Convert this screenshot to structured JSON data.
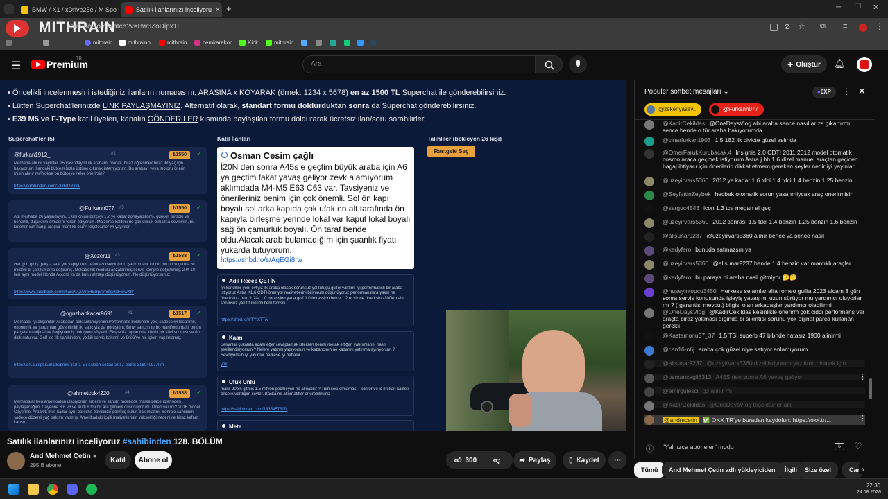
{
  "browser": {
    "tabs": [
      {
        "label": "BMW / X1 / xDrive25e / M Spo"
      },
      {
        "label": "Satılık ilanlarınızı inceliyoru"
      }
    ],
    "url": "youtube.com/watch?v=Bw6ZoDipx1I"
  },
  "bookmarks": [
    "mithrain",
    "mithrainn",
    "mithrain",
    "cemkarakoc",
    "Kick",
    "mithrain"
  ],
  "overlay": {
    "brand": "MITHRAIN"
  },
  "header": {
    "logo": "Premium",
    "logo_sup": "TR",
    "search_placeholder": "Ara",
    "create_label": "Oluştur"
  },
  "video": {
    "lines": [
      {
        "parts": [
          "• Öncelikli incelenmesini istediğiniz ilanların numarasını, ",
          "ARASINA x KOYARAK",
          " (örnek: 1234 x 5678) ",
          "en az 1500 TL",
          " Superchat ile gönderebilirsiniz."
        ]
      },
      {
        "parts": [
          "• Lütfen Superchat'lerinizde ",
          "LİNK PAYLAŞMAYINIZ",
          ". Alternatif olarak, ",
          "standart formu doldurduktan sonra",
          " da Superchat gönderebilirsiniz."
        ]
      },
      {
        "parts": [
          "• ",
          "E39 M5 ve F-Type",
          " katıl üyeleri, kanalın ",
          "GÖNDERİLER",
          " kısmında paylaşılan formu doldurarak ücretsiz ilan/soru sorabilirler."
        ]
      }
    ],
    "col_superchat": "Superchat'ler (5)",
    "col_katil": "Katıl İlanları",
    "col_talihli": "Talihliler (bekleyen 26 kişi)",
    "random_btn": "Rastgele Seç",
    "superchats": [
      {
        "name": "@furkan1912_",
        "num": "#2",
        "amt": "₺1550",
        "body": "Merhaba abi iyi yayınlar. 25 yaşındayım ilk arabamı olacak, biraz öğrenmek biraz ihtiyaç için bakıyorum. İlandaki bütçem fazla üstüne çıkmak istemiyorum. Bu arabayı veya motoru önerir misin,alınır mı?Yoksa bu bütçeye neler önerirsin?",
        "link": "https://sahibinden.com/1335848431"
      },
      {
        "name": "@Furkann077",
        "num": "#5",
        "amt": "₺1550",
        "body": "Abi merhaba 26 yaşındayım, 1.6m civarı(bütçeyi 1.7 ye kadar zorlayabilirim), güncel, turbolu ve benzinli, düşük km olmasını tercih ediyorum. Malzeme kalitesi de çok düşük olmazsa sevinirim, bu kriterler için hangi araçlar mantıklı olur? Teşekkürler iyi yayınlar.",
        "link": ""
      },
      {
        "name": "@Xezer11",
        "num": "#3",
        "amt": "₺1538",
        "body": "Her gün gidiş geliş 2 saat yol yapıyorum. Audi A5 bakıyorum. Şanzumanı 10 bin mil önce çıkma 8k mildeki bi şanzumanla değişmiş. Mekatronik modülü anzalanmış servis komple değiştirmiş. 2.0t 10 ileri aynı model Honda Accord ya da bunu almayı düşünüyorum. Ne düşünüyorsunuz",
        "link": "https://www.facebook.com/share/1Qi/WpHEHp/?mibextid=wwXIfr"
      },
      {
        "name": "@oguzhankacar9691",
        "num": "#1",
        "amt": "₺1517",
        "body": "Merhaba, iyi akşamlar. Arabadan pek anlamıyorum.Performans beklentim yok, sadece iyi tasarımlı, ekonomik ve şanzıman güvenilirliği iki satıcıyla da görüştüm. Bmw satıcısı turbo manifoldu daltil bütün parçaların orijinal ve değişmemiş olduğunu söyledi. Ekspertiz raporunda küçük bir süvi sızıntısı ve ön disk notu var. Golf ise ilk sahibinden, yetkili servis bakımlı ve DSG'ye hiç işlem yapılmamış.",
        "link": "https://en.autoplus.it/ads/bmw-318-1-5-i-saloon-sedan-2017-petrol-31604097.html"
      },
      {
        "name": "@ahmetcbk4220",
        "num": "#4",
        "amt": "₺1538",
        "body": "Merhabalar ben amerikadan ulaşıyorum sizlere ve ilanları facebook marketplace üzerinden paylaşacağım. Cayenne 3.6 v6 ve Audi 8 tfsi bir ara gitmeyi düşünüyorum. Öneri var mı? 2016 model Cayenne. Ara 80k mile kadar aynı porsche bayisinde görmüş bütün bakımlarını. Sonraki sahibinin sadece düzenli yağ bakımı yapmış. Amerikadaki içgili maliyetlerinin yüksekliği nedeniyle biraz kafam karıştı.",
        "link": ""
      }
    ],
    "katil": [
      {
        "name": "Osman Cesim çağlı",
        "body": "İ20N den sonra A45s e geçtim büyük araba için A6 ya geçtim fakat yavaş geliyor zevk alamıyorum aklımdada M4-M5 E63 C63 var. Tavsiyeniz ve önerileriniz benim için çok önemli. Sol ön kapı boyalı sol arka kapıda çok ufak en alt tarafında ön kapıyla birleşme yerinde lokal var kaput lokal boyalı sağ ön çamurluk boyalı. Ön taraf bende oldu.Alacak arab bulamadığım için şuanlık fiyatı yukarda tutuyorum.",
        "link": "https://shbd.io/s/AgEGi8rw"
      },
      {
        "name": "Adil Recep ÇETİN",
        "body": "İyi kandiller yeni evliyiz ilk araba olacak sorunsuz yol tutuşu güzel yalıtımı iyi performanslı bir araba istiyoruz Astra K1.6 CDTI öneriyor maliyetlerini biliyorum düşünüyoruz performanslara yakın ne önerirsiniz polo 1.2tsi 1.0 imrassion yada golf 1.0 imrassion bulce 1.2 m siz ne önerirsiniz100km altı sorunsuz yakıt tüketimi hem temsili",
        "link": "https://shbd.io/s/TYfXTTA"
      },
      {
        "name": "Kaan",
        "body": "Selamlar çukalata adam eğer cevaplamak istersen benim merak ettiğim yatırımlarını nasıl şekillendiriyorsun ? Nelere yatırım yapıyorsun ve kazancının ne kadarını yatırıma ayırıyorsun ? Sevdiyorsun iyi yayınlar herkese iyi haftalar",
        "link": "yok"
      },
      {
        "name": "Ufuk Unlu",
        "body": "maks 20bin gitmiş 1.5 milyon gecmeyen ne alınabilir ? Trim sesi olmaması , konfor ve ic mekan kaliteli öncelik verdigim seyler. Baska ne alternatifler önerebilirsiniz",
        "link": "https://sahibinden.com/1335457300"
      },
      {
        "name": "Mete",
        "body": "",
        "link": ""
      }
    ]
  },
  "meta": {
    "title_plain": "Satılık ilanlarınızı inceliyoruz ",
    "title_tag": "#sahibinden",
    "title_ep": " 128. BÖLÜM",
    "channel": "And Mehmet Çetin",
    "subs": "295 B abone",
    "join": "Katıl",
    "subscribe": "Abone ol",
    "likes": "300",
    "share": "Paylaş",
    "save": "Kaydet"
  },
  "chat": {
    "title": "Popüler sohbet mesajları",
    "xp": "0XP",
    "pinned": [
      "@zekeriyasev...",
      "@Furkann077"
    ],
    "messages": [
      {
        "a": "@KadirCekildas",
        "t": "@OneDaysVlog abi araba sence nasıl arıza çıkartırmı sence bende o tür araba bakıyorumda",
        "c": "#777"
      },
      {
        "a": "@cinarfurkan1903",
        "t": "1.5 182 lik civicte güzel aslında",
        "c": "#1a9e8a"
      },
      {
        "a": "@OmerFarukKurubacak.4",
        "t": "Insignia 2.0 CDTI 2011 2012 model otomatik cosmo araca geçmek istiyorum Astra j hb 1.6 dizel manuel araçtan geçicen bagaj ihtiyacı için önerilerin dikkat etmem gereken şeyler nedir iyi yayinlar",
        "c": "#333"
      },
      {
        "a": "@uzeyirvars5360",
        "t": "2012 ye kadar 1.6 tdci 1.4 tdci 1.4 benzin 1.25 benzin",
        "c": "#8a8a6a"
      },
      {
        "a": "@SeyfettinZeybek",
        "t": "hecbek otomatik sorun yasanmiycak araç onerirmisin",
        "c": "#2a8a4a"
      },
      {
        "a": "@sarguc4543",
        "t": "icon 1.3 tce megan al geç",
        "c": "#111"
      },
      {
        "a": "@uzeyirvars5360",
        "t": "2012 sonrası 1.5 tdci 1.4 benzin 1.25 benzin 1.6 benzin",
        "c": "#8a8a6a"
      },
      {
        "a": "@alisunar9237",
        "t": "@uzeyirvars5360 alınır bence ya sence nasıl",
        "c": "#222"
      },
      {
        "a": "@kedyfero",
        "t": "bunuda satmazsın ya",
        "c": "#5a4a7a"
      },
      {
        "a": "@uzeyirvars5360",
        "t": "@alisunar9237 bende 1.4 benzin var mantıklı araçlar",
        "c": "#8a8a6a"
      },
      {
        "a": "@kedyfero",
        "t": "bu paraya bi araba nasil gitmiyor 🤔🤔",
        "c": "#5a4a7a"
      },
      {
        "a": "@huseyintopcu3450",
        "t": "Herkese selamlar alfa romeo guilia 2023 alcam 3 gün sonra servis konusunda işleyiş yavaş mı uzun sürüyor mu yardımcı oluyorlar mı ? ( garantisi mevcut) bilgisi olan arkadaşlar yardımcı olabilirmi",
        "c": "#6a3fd0"
      },
      {
        "a": "@OneDaysVlog",
        "t": "@KadirCekildas kesinlikle önerirm çok ciddi performans var araçta biraz yakması dışında bi sıkıntısı sorunu yok orjinal parça kullanan gerekli",
        "c": "#777"
      },
      {
        "a": "@Kastamonu37_37",
        "t": "1.5 TSI superb 47 bibnde hatasız 1900 alinirmi",
        "c": "#111"
      },
      {
        "a": "@can16-n6j",
        "t": "araba çok güzel niye satıyor anlamıyorum",
        "c": "#3a7ad0"
      },
      {
        "a": "@alisunar9237",
        "t": "@uzeyirvars5360 dizel istiyorum yazılımlı binmek için",
        "c": "#222"
      },
      {
        "a": "@osmancagli6313",
        "t": "A45S den sonra A6 yavaş geliyor",
        "c": "#555"
      },
      {
        "a": "@emirgulesci",
        "t": "g3 alınır mı",
        "c": "#444"
      },
      {
        "a": "@KadirCekildas",
        "t": "@OneDaysVlog teşekkürler abi",
        "c": "#777"
      },
      {
        "a": "@andmcetin",
        "t": "✅ OKX TR'ye buradan kaydolun: https://okx.tr/...",
        "c": "#8a6a4a"
      }
    ],
    "subscriber_mode": "\"Yalnızca aboneler\" modu"
  },
  "chips": [
    "Tümü",
    "And Mehmet Çetin adlı yükleyiciden",
    "İlgili",
    "Size özel",
    "Canlı"
  ],
  "taskbar": {
    "time": "22:30",
    "date": "24.08.2026"
  }
}
